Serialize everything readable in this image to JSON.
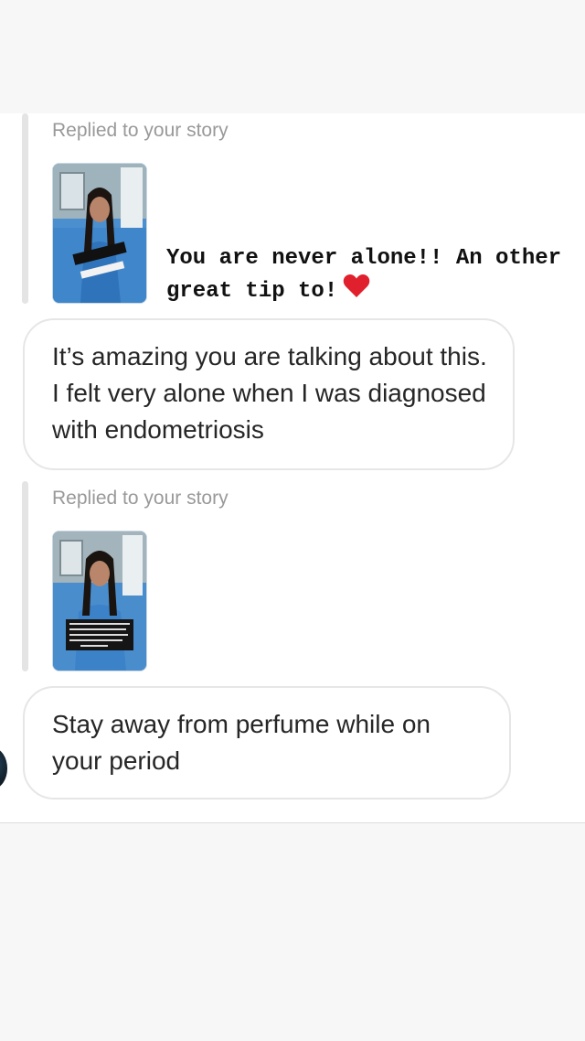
{
  "colors": {
    "chat_background": "#ffffff",
    "page_background": "#f7f7f7",
    "bubble_border": "#e6e6e6",
    "secondary_text": "#999999",
    "heart": "#e0202c"
  },
  "messages": [
    {
      "reply_label": "Replied to your story",
      "story_caption": "You are never alone!! An other great tip to!",
      "caption_emoji": "heart-icon",
      "text": "It’s amazing you are talking about this. I felt very alone when I was diagnosed with endometriosis"
    },
    {
      "reply_label": "Replied to your story",
      "text": "Stay away from perfume while on your period"
    }
  ]
}
